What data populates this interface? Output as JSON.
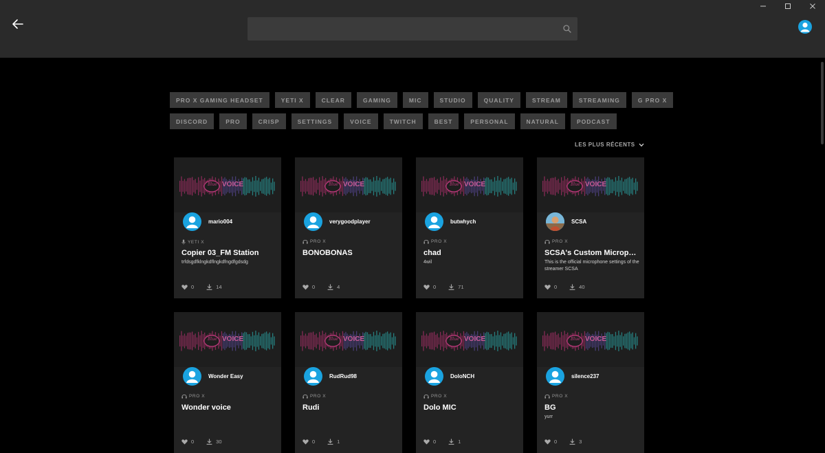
{
  "search": {
    "placeholder": "",
    "value": ""
  },
  "tags": [
    [
      "PRO X GAMING HEADSET",
      "YETI X",
      "CLEAR",
      "GAMING",
      "MIC",
      "STUDIO",
      "QUALITY",
      "STREAM",
      "STREAMING",
      "G PRO X"
    ],
    [
      "DISCORD",
      "PRO",
      "CRISP",
      "SETTINGS",
      "VOICE",
      "TWITCH",
      "BEST",
      "PERSONAL",
      "NATURAL",
      "PODCAST"
    ]
  ],
  "sort": {
    "label": "LES PLUS RÉCENTS"
  },
  "banner": {
    "brand": "Blue",
    "word": "VOICE"
  },
  "cards": [
    {
      "author": "mario004",
      "device": "YETI X",
      "device_icon": "mic-icon",
      "title": "Copier 03_FM Station",
      "desc": "trfdsgdfklngkdflngkdfngdfgdsdg",
      "likes": "0",
      "downloads": "14",
      "photo": false
    },
    {
      "author": "verygoodplayer",
      "device": "PRO X",
      "device_icon": "headset-icon",
      "title": "BONOBONAS",
      "desc": "",
      "likes": "0",
      "downloads": "4",
      "photo": false
    },
    {
      "author": "butwhych",
      "device": "PRO X",
      "device_icon": "headset-icon",
      "title": "chad",
      "desc": "4wil",
      "likes": "0",
      "downloads": "71",
      "photo": false
    },
    {
      "author": "SCSA",
      "device": "PRO X",
      "device_icon": "headset-icon",
      "title": "SCSA's Custom Microphone Settings",
      "desc": "This is the official microphone settings of the streamer SCSA",
      "likes": "0",
      "downloads": "40",
      "photo": true
    },
    {
      "author": "Wonder Easy",
      "device": "PRO X",
      "device_icon": "headset-icon",
      "title": "Wonder voice",
      "desc": "",
      "likes": "0",
      "downloads": "30",
      "photo": false
    },
    {
      "author": "RudRud98",
      "device": "PRO X",
      "device_icon": "headset-icon",
      "title": "Rudi",
      "desc": "",
      "likes": "0",
      "downloads": "1",
      "photo": false
    },
    {
      "author": "DoloNCH",
      "device": "PRO X",
      "device_icon": "headset-icon",
      "title": "Dolo MIC",
      "desc": "",
      "likes": "0",
      "downloads": "1",
      "photo": false
    },
    {
      "author": "silence237",
      "device": "PRO X",
      "device_icon": "headset-icon",
      "title": "BG",
      "desc": "yurr",
      "likes": "0",
      "downloads": "3",
      "photo": false
    }
  ],
  "colors": {
    "accent": "#1aa3e0",
    "header_bg": "#2a2a2a",
    "card_bg": "#232323",
    "tag_bg": "#3a3a3a"
  }
}
